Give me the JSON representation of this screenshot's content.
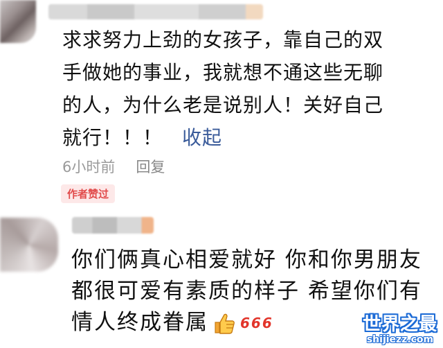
{
  "comments": [
    {
      "lines": [
        "求求努力上劲的女孩子，靠自己的双",
        "手做她的事业，我就想不通这些无聊",
        "的人，为什么老是说别人！关好自己",
        "就行！！！"
      ],
      "collapse_label": "收起",
      "time": "6小时前",
      "reply_label": "回复",
      "badge": "作者赞过"
    },
    {
      "lines": [
        "你们俩真心相爱就好 你和你男朋友",
        "都很可爱有素质的样子 希望你们有",
        "情人终成眷属"
      ],
      "emojis": [
        "thumbs-up-icon",
        "666-icon"
      ],
      "emoji_666_text": "666"
    }
  ],
  "watermark": {
    "title": "世界之最",
    "url": "shijiezz.com"
  },
  "colors": {
    "text": "#111111",
    "link": "#3a5b9a",
    "meta": "#9a9a9a",
    "badge_bg": "#fde8e8",
    "badge_text": "#e14b4b",
    "watermark": "#1c6bd6"
  }
}
